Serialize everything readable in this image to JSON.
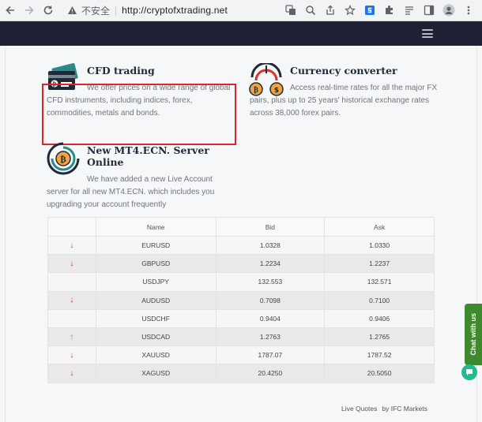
{
  "browser": {
    "security_label": "不安全",
    "url": "http://cryptofxtrading.net"
  },
  "features": [
    {
      "title": "CFD trading",
      "description": "We offer prices on a wide range of global CFD instruments, including indices, forex, commodities, metals and bonds."
    },
    {
      "title": "Currency converter",
      "description": "Access real-time rates for all the major FX pairs, plus up to 25 years' historical exchange rates across 38,000 forex pairs."
    },
    {
      "title": "New MT4.ECN. Server Online",
      "description": "We have added a new Live Account server for all new MT4.ECN. which includes you upgrading your account frequently"
    }
  ],
  "table": {
    "headers": [
      "Name",
      "Bid",
      "Ask"
    ],
    "rows": [
      {
        "trend": "down",
        "name": "EURUSD",
        "bid": "1.0328",
        "ask": "1.0330"
      },
      {
        "trend": "down",
        "name": "GBPUSD",
        "bid": "1.2234",
        "ask": "1.2237"
      },
      {
        "trend": "",
        "name": "USDJPY",
        "bid": "132.553",
        "ask": "132.571"
      },
      {
        "trend": "down",
        "name": "AUDUSD",
        "bid": "0.7098",
        "ask": "0.7100"
      },
      {
        "trend": "",
        "name": "USDCHF",
        "bid": "0.9404",
        "ask": "0.9406"
      },
      {
        "trend": "up",
        "name": "USDCAD",
        "bid": "1.2763",
        "ask": "1.2765"
      },
      {
        "trend": "down",
        "name": "XAUUSD",
        "bid": "1787.07",
        "ask": "1787.52"
      },
      {
        "trend": "down",
        "name": "XAGUSD",
        "bid": "20.4250",
        "ask": "20.5050"
      }
    ]
  },
  "footer": {
    "link": "Live Quotes",
    "credit": "by IFC Markets"
  },
  "chat": {
    "label": "Chat with us"
  },
  "colors": {
    "header_bg": "#1f2235",
    "highlight": "#e0242a",
    "down": "#d0322d",
    "up": "#46b04a",
    "chat": "#3f8a2f"
  }
}
